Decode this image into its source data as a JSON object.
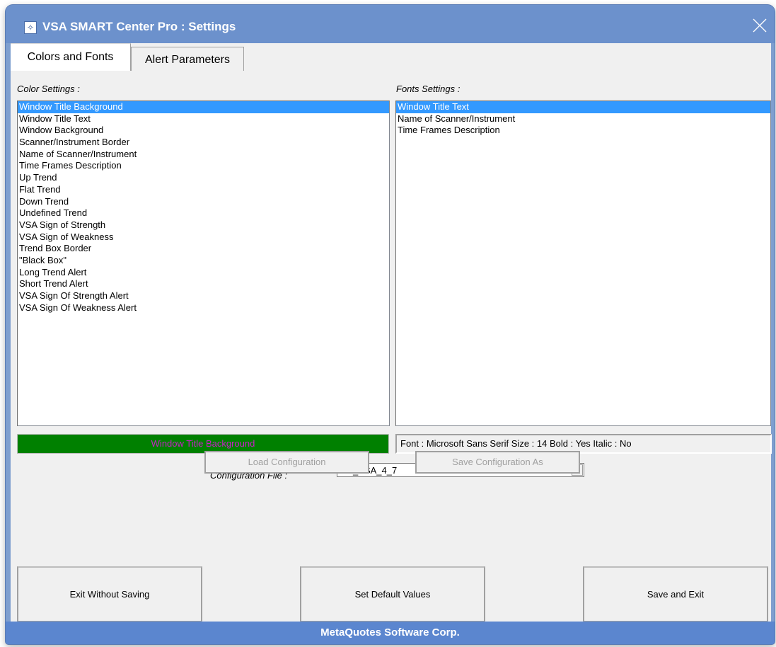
{
  "window": {
    "title": "VSA SMART Center Pro : Settings",
    "footer": "MetaQuotes Software Corp."
  },
  "tabs": [
    {
      "label": "Colors and Fonts",
      "active": true
    },
    {
      "label": "Alert Parameters",
      "active": false
    }
  ],
  "color_settings": {
    "label": "Color Settings :",
    "selected_index": 0,
    "items": [
      "Window Title Background",
      "Window Title Text",
      "Window Background",
      "Scanner/Instrument Border",
      "Name of Scanner/Instrument",
      "Time Frames Description",
      "Up Trend",
      "Flat Trend",
      "Down Trend",
      "Undefined Trend",
      "VSA Sign of Strength",
      "VSA Sign of Weakness",
      "Trend Box Border",
      "\"Black Box\"",
      "Long Trend Alert",
      "Short Trend Alert",
      "VSA Sign Of Strength Alert",
      "VSA Sign Of Weakness Alert"
    ],
    "preview_text": "Window Title Background",
    "preview_bg": "#008000",
    "preview_fg": "#c81ec8"
  },
  "fonts_settings": {
    "label": "Fonts Settings :",
    "selected_index": 0,
    "items": [
      "Window Title Text",
      "Name of Scanner/Instrument",
      "Time Frames Description"
    ],
    "info": "Font : Microsoft Sans Serif   Size : 14   Bold : Yes   Italic : No"
  },
  "configuration": {
    "label": "Configuration File :",
    "value": "TG_VSA_4_7",
    "load_label": "Load Configuration",
    "save_as_label": "Save Configuration As"
  },
  "actions": {
    "exit_label": "Exit Without Saving",
    "defaults_label": "Set Default Values",
    "save_exit_label": "Save and Exit"
  },
  "icons": {
    "app": "app-icon",
    "close": "close-icon",
    "dropdown": "chevron-down-icon"
  },
  "colors": {
    "titlebar": "#6c91cc",
    "footer": "#5b86cf",
    "selection": "#3399ff"
  }
}
